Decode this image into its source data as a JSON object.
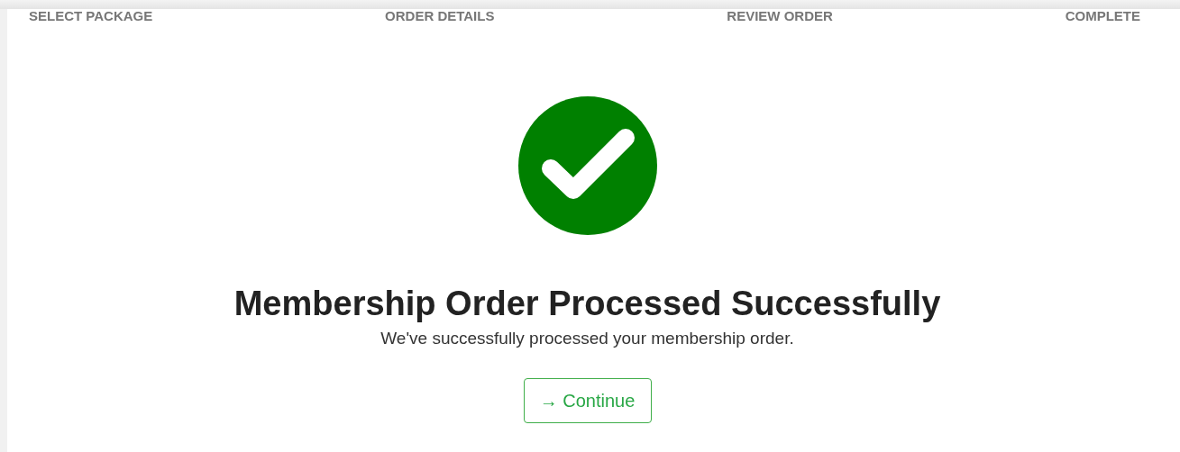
{
  "steps": [
    {
      "label": "SELECT PACKAGE"
    },
    {
      "label": "ORDER DETAILS"
    },
    {
      "label": "REVIEW ORDER"
    },
    {
      "label": "COMPLETE"
    }
  ],
  "title": "Membership Order Processed Successfully",
  "message": "We've successfully processed your membership order.",
  "button": {
    "label": "Continue",
    "icon": "→"
  }
}
